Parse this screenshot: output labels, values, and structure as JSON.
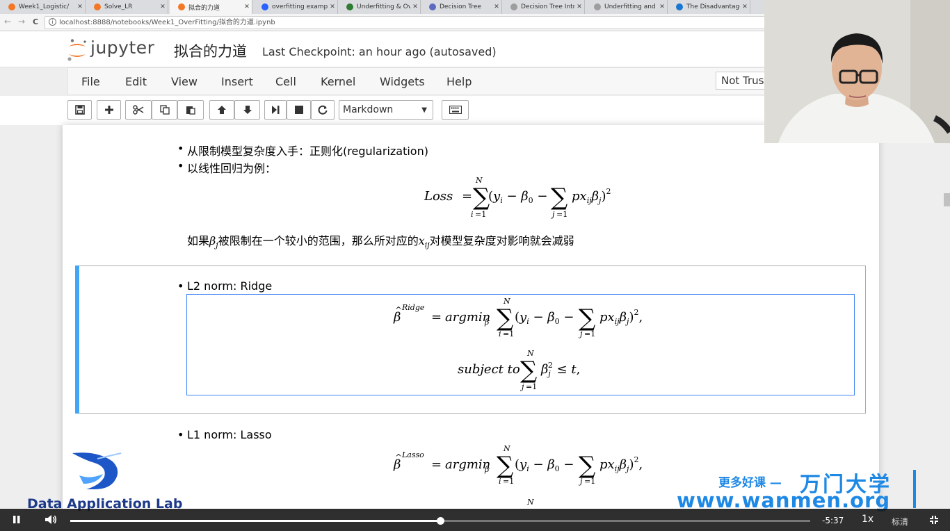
{
  "browser": {
    "tabs": [
      {
        "title": "Week1_Logistic/",
        "icon_color": "#f37726",
        "active": false
      },
      {
        "title": "Solve_LR",
        "icon_color": "#f37726",
        "active": false
      },
      {
        "title": "拟合的力道",
        "icon_color": "#f37726",
        "active": true
      },
      {
        "title": "overfitting exampl",
        "icon_color": "#2962ff",
        "active": false
      },
      {
        "title": "Underfitting & Ov",
        "icon_color": "#2e7d32",
        "active": false
      },
      {
        "title": "Decision Tree",
        "icon_color": "#5c6bc0",
        "active": false
      },
      {
        "title": "Decision Tree Intr",
        "icon_color": "#9e9e9e",
        "active": false
      },
      {
        "title": "Underfitting and C",
        "icon_color": "#9e9e9e",
        "active": false
      },
      {
        "title": "The Disadvantage",
        "icon_color": "#1976d2",
        "active": false
      }
    ],
    "close_glyph": "✕",
    "url": "localhost:8888/notebooks/Week1_OverFitting/拟合的力道.ipynb",
    "info_glyph": "i",
    "back_glyph": "←",
    "forward_glyph": "→",
    "reload_glyph": "C"
  },
  "jupyter": {
    "logo_text": "jupyter",
    "notebook_name": "拟合的力道",
    "checkpoint": "Last Checkpoint: an hour ago (autosaved)",
    "menu": [
      "File",
      "Edit",
      "View",
      "Insert",
      "Cell",
      "Kernel",
      "Widgets",
      "Help"
    ],
    "trust_label": "Not Trusted",
    "cell_type": "Markdown",
    "toolbar_icons": [
      "save-icon",
      "plus-icon",
      "cut-icon",
      "copy-icon",
      "paste-icon",
      "arrow-up-icon",
      "arrow-down-icon",
      "step-forward-icon",
      "stop-icon",
      "restart-icon",
      "keyboard-icon"
    ]
  },
  "content": {
    "bullet1": "从限制模型复杂度入手：正则化(regularization)",
    "bullet2": "以线性回归为例：",
    "loss_lhs": "Loss",
    "para_prefix": "如果",
    "para_middle": "被限制在一个较小的范围，那么所对应的",
    "para_suffix": "对模型复杂度对影响就会减弱",
    "ridge_title": "L2 norm: Ridge",
    "ridge_sup": "Ridge",
    "argmin": "argmin",
    "subject_to": "subject to",
    "lasso_title": "L1 norm: Lasso",
    "lasso_sup": "Lasso"
  },
  "watermark": {
    "lab_name": "Data Application Lab",
    "promo_line1": "更多好课 —",
    "promo_brand": "万门大学",
    "promo_url": "www.wanmen.org"
  },
  "video": {
    "progress": 0.5,
    "time_remaining": "-5:37",
    "speed": "1x",
    "quality": "标清"
  },
  "colors": {
    "accent_blue": "#42a5f5",
    "jupyter_orange": "#f37726",
    "brand_blue": "#1e88e5"
  }
}
